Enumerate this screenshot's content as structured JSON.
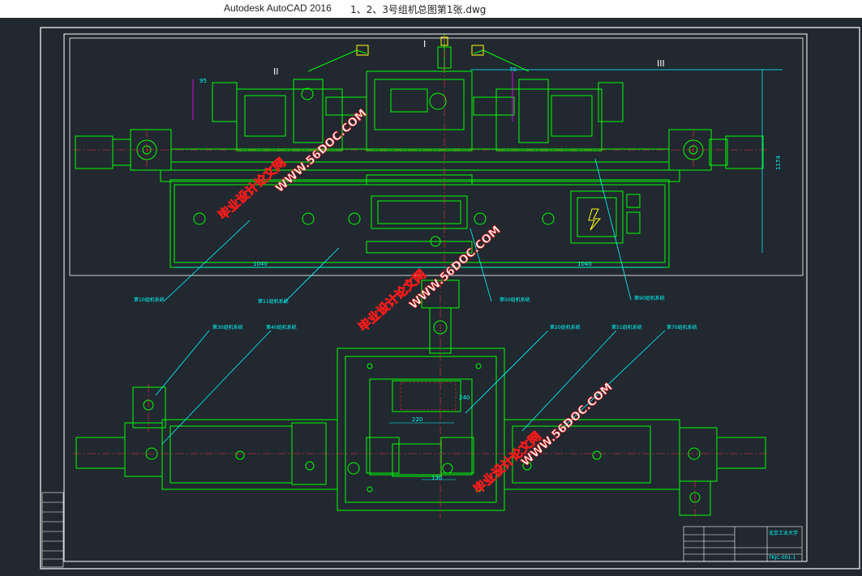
{
  "window": {
    "app_title": "Autodesk AutoCAD 2016",
    "file_name": "1、2、3号组机总图第1张.dwg"
  },
  "drawing": {
    "roman_labels": [
      "I",
      "II",
      "III"
    ],
    "dimensions": {
      "d95": "95",
      "d70": "70",
      "d1040_left": "1040",
      "d1040_right": "1040",
      "d1174": "1174",
      "d240": "240",
      "d220": "220",
      "d130": "130"
    },
    "part_labels": {
      "p10": "第10组机系统",
      "p11": "第11组机系统",
      "p50": "第50组机系统",
      "p90": "第90组机系统",
      "p30": "第30组机系统",
      "p40": "第40组机系统",
      "p20": "第20组机系统",
      "p51": "第51组机系统",
      "p70": "第70组机系统"
    },
    "watermarks": {
      "site": "WWW.56DOC.COM",
      "cn": "毕业设计论文网"
    },
    "title_block": {
      "school": "北京工业大学",
      "drawing_no": "TKJC-001-1"
    }
  },
  "colors": {
    "background": "#212830",
    "machine": "#00ff00",
    "leader": "#00ffff",
    "dimension": "#00ffff",
    "centerline": "#ff3030",
    "dimension_red": "#ff2a2a",
    "watermark": "#ff1a1a",
    "frame": "#ffffff",
    "hatch_magenta": "#ff00ff",
    "yellow": "#ffff00"
  }
}
